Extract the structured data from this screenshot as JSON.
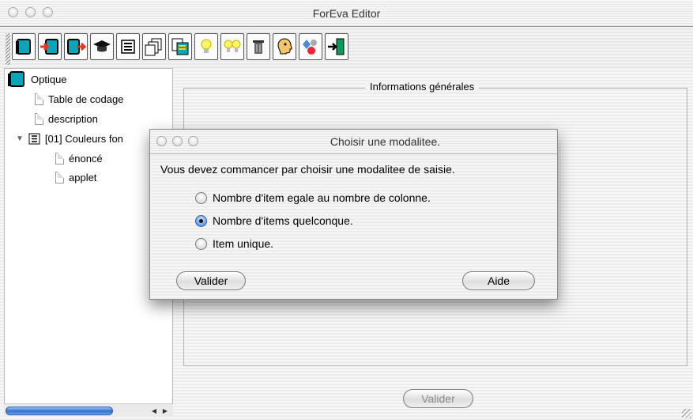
{
  "window": {
    "title": "ForEva Editor"
  },
  "toolbar": {
    "buttons": [
      {
        "icon": "book-icon"
      },
      {
        "icon": "book-add-icon"
      },
      {
        "icon": "book-remove-icon"
      },
      {
        "icon": "graduation-cap-icon"
      },
      {
        "icon": "form-icon"
      },
      {
        "icon": "pages-icon"
      },
      {
        "icon": "copy-pages-icon"
      },
      {
        "icon": "lightbulb-icon"
      },
      {
        "icon": "double-lightbulb-icon"
      },
      {
        "icon": "trash-icon"
      },
      {
        "icon": "head-profile-icon"
      },
      {
        "icon": "shapes-icon"
      },
      {
        "icon": "exit-door-icon"
      }
    ]
  },
  "tree": {
    "root": "Optique",
    "items": [
      "Table de codage",
      "description"
    ],
    "group": "[01] Couleurs fon",
    "children": [
      "énoncé",
      "applet"
    ]
  },
  "main": {
    "legend": "Informations générales",
    "valider": "Valider"
  },
  "dialog": {
    "title": "Choisir une modalitee.",
    "message": "Vous devez commancer par choisir une modalitee de saisie.",
    "options": [
      {
        "label": "Nombre d'item egale au nombre de colonne.",
        "selected": false
      },
      {
        "label": "Nombre d'items quelconque.",
        "selected": true
      },
      {
        "label": "Item unique.",
        "selected": false
      }
    ],
    "valider": "Valider",
    "aide": "Aide"
  },
  "colors": {
    "accent": "#3a7fe0",
    "tree_bg": "#ffffff"
  }
}
